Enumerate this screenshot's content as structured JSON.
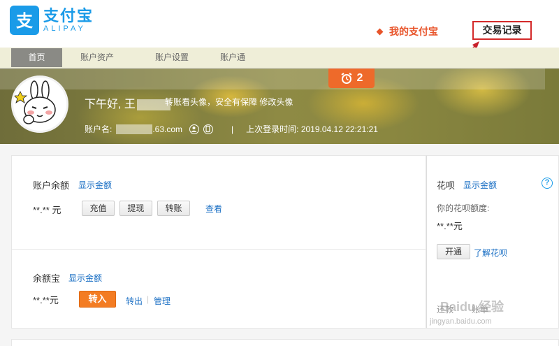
{
  "header": {
    "logo_cn": "支付宝",
    "logo_en": "ALIPAY",
    "my_alipay": "我的支付宝",
    "trade_record": "交易记录"
  },
  "nav": {
    "items": [
      {
        "label": "首页",
        "active": true
      },
      {
        "label": "账户资产"
      },
      {
        "label": "账户设置"
      },
      {
        "label": "账户通"
      }
    ]
  },
  "banner": {
    "alarm_count": "2",
    "greeting": "下午好, 王",
    "avatar_hint": "转账看头像，安全有保障",
    "edit_avatar": "修改头像",
    "account_label": "账户名:",
    "account_suffix": ".63.com",
    "separator": "|",
    "last_login": "上次登录时间: 2019.04.12 22:21:21"
  },
  "balance": {
    "title": "账户余额",
    "show_amount": "显示金额",
    "value": "**.** 元",
    "recharge": "充值",
    "withdraw": "提现",
    "transfer": "转账",
    "view": "查看"
  },
  "yuebao": {
    "title": "余额宝",
    "show_amount": "显示金额",
    "value": "**.**元",
    "transfer_in": "转入",
    "transfer_out": "转出",
    "divider": "|",
    "manage": "管理"
  },
  "huabei": {
    "title": "花呗",
    "show_amount": "显示金额",
    "help": "?",
    "quota_label": "你的花呗额度:",
    "quota_value": "**.**元",
    "open": "开通",
    "learn": "了解花呗",
    "repay": "还款",
    "bill": "账单"
  },
  "watermark": {
    "text": "Baidu 经验",
    "url": "jingyan.baidu.com"
  },
  "colors": {
    "brand_blue": "#1a9be8",
    "accent_orange": "#f37c23",
    "highlight_red": "#d42a2a"
  }
}
